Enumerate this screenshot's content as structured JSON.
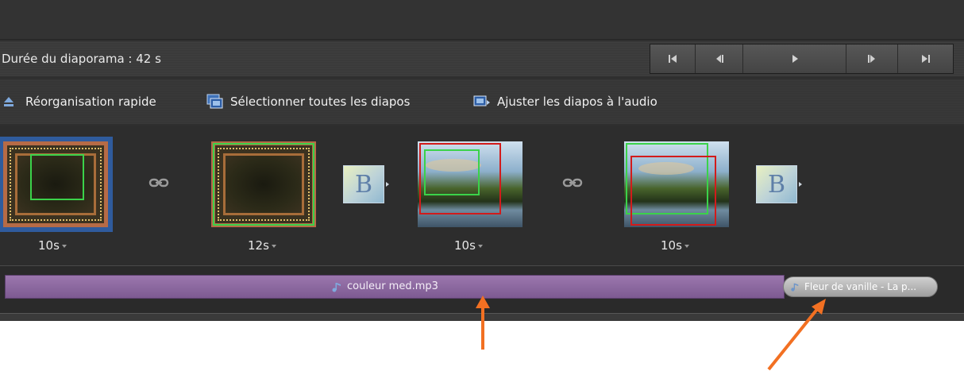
{
  "header": {
    "duration_label": "Durée du diaporama : 42 s"
  },
  "transport": {
    "buttons": [
      {
        "name": "skip-to-start",
        "icon": "skip-start-icon"
      },
      {
        "name": "previous",
        "icon": "step-back-icon"
      },
      {
        "name": "play",
        "icon": "play-icon"
      },
      {
        "name": "next",
        "icon": "step-forward-icon"
      },
      {
        "name": "skip-to-end",
        "icon": "skip-end-icon"
      }
    ]
  },
  "actions": {
    "quick_reorder": "Réorganisation rapide",
    "select_all": "Sélectionner toutes les diapos",
    "fit_to_audio": "Ajuster les diapos à l'audio"
  },
  "slides": [
    {
      "duration": "10s",
      "selected": true,
      "kind": "title-card"
    },
    {
      "duration": "12s",
      "selected": false,
      "kind": "title-card"
    },
    {
      "duration": "10s",
      "selected": false,
      "kind": "photo"
    },
    {
      "duration": "10s",
      "selected": false,
      "kind": "photo"
    }
  ],
  "audio": {
    "track1": "couleur med.mp3",
    "track2": "Fleur de vanille - La p..."
  },
  "colors": {
    "accent_selection": "#2f5b9d",
    "audio_track": "#8b67a0",
    "annotation_arrow": "#f27022",
    "pan_zoom_start": "#3bd24a",
    "pan_zoom_end": "#d21b1b"
  }
}
